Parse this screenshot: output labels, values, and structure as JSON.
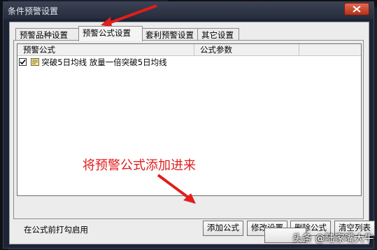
{
  "window": {
    "title": "条件预警设置"
  },
  "tabs": [
    {
      "label": "预警品种设置"
    },
    {
      "label": "预警公式设置"
    },
    {
      "label": "套利预警设置"
    },
    {
      "label": "其它设置"
    }
  ],
  "list": {
    "columns": [
      "预警公式",
      "公式参数"
    ],
    "rows": [
      {
        "checked": true,
        "formula": "突破5日均线 放量一倍突破5日均线",
        "params": ""
      }
    ]
  },
  "status_text": "在公式前打勾启用",
  "buttons": {
    "add": "添加公式",
    "edit": "修改设置",
    "delete": "删除公式",
    "clear": "清空列表"
  },
  "annotation": {
    "text": "将预警公式添加进来",
    "color": "#e11d1d"
  },
  "watermark": "头条 @陆家嘴大牛",
  "icons": {
    "title": "app-icon",
    "close": "close-icon",
    "row": "formula-icon"
  }
}
